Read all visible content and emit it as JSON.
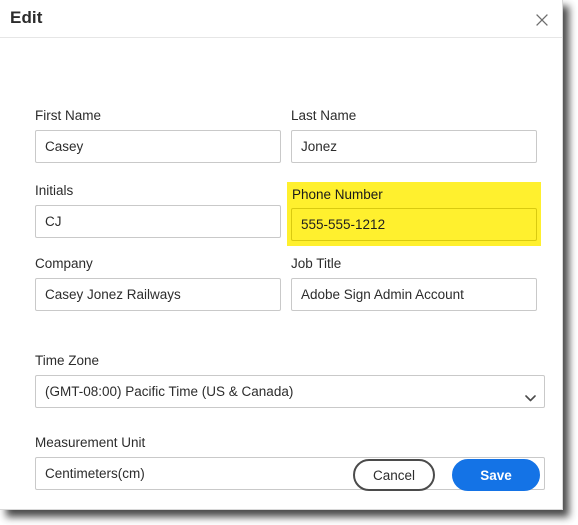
{
  "dialog": {
    "title": "Edit",
    "close_icon": "close-x-icon"
  },
  "fields": {
    "first_name": {
      "label": "First Name",
      "value": "Casey",
      "placeholder": ""
    },
    "last_name": {
      "label": "Last Name",
      "value": "Jonez",
      "placeholder": ""
    },
    "initials": {
      "label": "Initials",
      "value": "CJ",
      "placeholder": ""
    },
    "phone_number": {
      "label": "Phone Number",
      "value": "555-555-1212",
      "placeholder": "",
      "highlight_color": "#FFF02E",
      "highlighted": true
    },
    "company": {
      "label": "Company",
      "value": "Casey Jonez Railways",
      "placeholder": ""
    },
    "job_title": {
      "label": "Job Title",
      "value": "Adobe Sign Admin Account",
      "placeholder": ""
    },
    "time_zone": {
      "label": "Time Zone",
      "selected": "(GMT-08:00) Pacific Time (US & Canada)",
      "chevron_icon": "chevron-down-icon"
    },
    "measurement_unit": {
      "label": "Measurement Unit",
      "selected": "Centimeters(cm)",
      "chevron_icon": "chevron-down-icon"
    }
  },
  "footer": {
    "cancel_label": "Cancel",
    "save_label": "Save",
    "save_color": "#1473E6"
  }
}
